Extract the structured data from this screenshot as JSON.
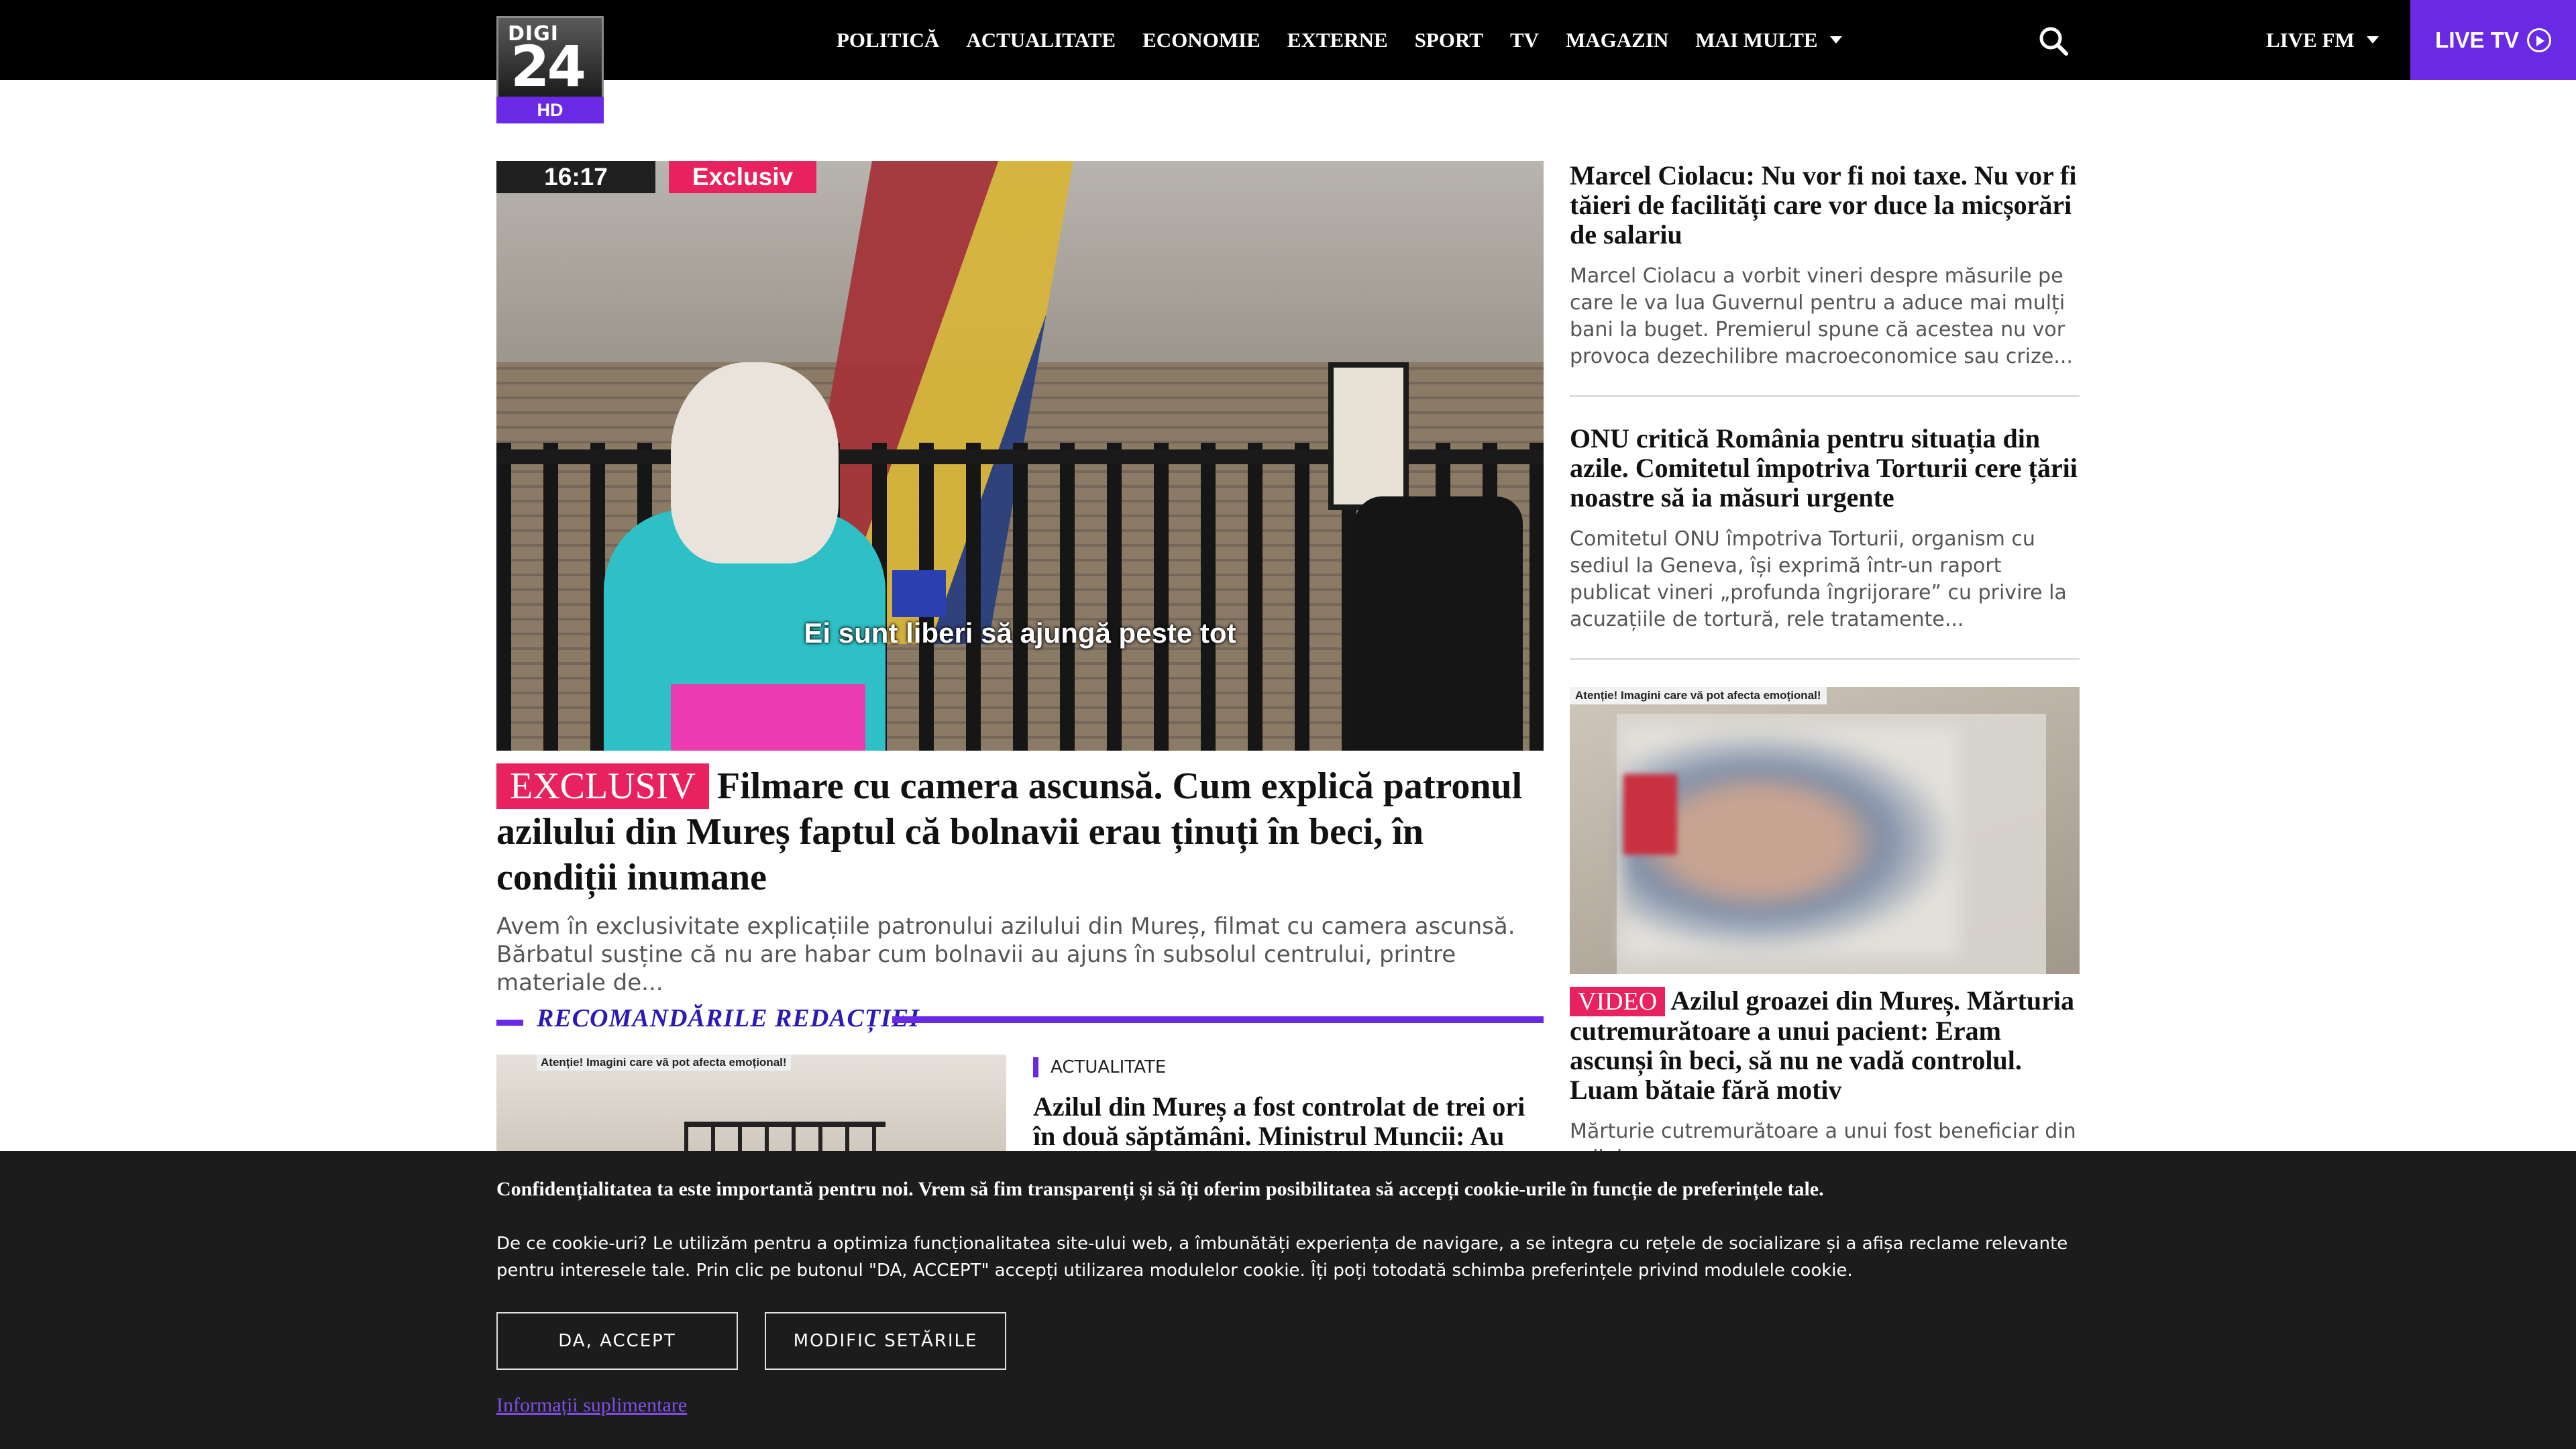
{
  "header": {
    "logo_top": "DIGI",
    "logo_main": "24",
    "logo_hd": "HD",
    "nav": [
      "POLITICĂ",
      "ACTUALITATE",
      "ECONOMIE",
      "EXTERNE",
      "SPORT",
      "TV",
      "MAGAZIN",
      "MAI MULTE"
    ],
    "live_fm": "LIVE FM",
    "live_tv": "LIVE TV"
  },
  "hero": {
    "time": "16:17",
    "badge": "Exclusiv",
    "subtitle": "Ei sunt liberi să ajungă peste tot",
    "tag": "EXCLUSIV",
    "title": "Filmare cu camera ascunsă. Cum explică patronul azilului din Mureș faptul că bolnavii erau ținuți în beci, în condiții inumane",
    "desc": "Avem în exclusivitate explicațiile patronului azilului din Mureș, filmat cu camera ascunsă. Bărbatul susține că nu are habar cum bolnavii au ajuns în subsolul centrului, printre materiale de..."
  },
  "recommend": {
    "heading": "RECOMANDĂRILE REDACȚIEI",
    "img_warning": "Atenție! Imagini care vă pot afecta emoțional!",
    "category": "ACTUALITATE",
    "title": "Azilul din Mureș a fost controlat de trei ori în două săptămâni. Ministrul Muncii: Au"
  },
  "side": [
    {
      "title": "Marcel Ciolacu: Nu vor fi noi taxe. Nu vor fi tăieri de facilități care vor duce la micșorări de salariu",
      "desc": "Marcel Ciolacu a vorbit vineri despre măsurile pe care le va lua Guvernul pentru a aduce mai mulți bani la buget. Premierul spune că acestea nu vor provoca dezechilibre macroeconomice sau crize..."
    },
    {
      "title": "ONU critică România pentru situația din azile. Comitetul împotriva Torturii cere țării noastre să ia măsuri urgente",
      "desc": "Comitetul ONU împotriva Torturii, organism cu sediul la Geneva, își exprimă într-un raport publicat vineri „profunda îngrijorare” cu privire la acuzațiile de tortură, rele tratamente..."
    },
    {
      "img_warning": "Atenție! Imagini care vă pot afecta emoțional!",
      "tag": "VIDEO",
      "title": "Azilul groazei din Mureș. Mărturia cutremurătoare a unui pacient: Eram ascunși în beci, să nu ne vadă controlul. Luam bătaie fără motiv",
      "desc": "Mărturie cutremurătoare a unui fost beneficiar din azilul"
    }
  ],
  "cookie": {
    "title": "Confidențialitatea ta este importantă pentru noi. Vrem să fim transparenți și să îți oferim posibilitatea să accepți cookie-urile în funcție de preferințele tale.",
    "body": "De ce cookie-uri? Le utilizăm pentru a optimiza funcționalitatea site-ului web, a îmbunătăți experiența de navigare, a se integra cu rețele de socializare și a afișa reclame relevante pentru interesele tale. Prin clic pe butonul \"DA, ACCEPT\" accepți utilizarea modulelor cookie. Îți poți totodată schimba preferințele privind modulele cookie.",
    "accept": "DA, ACCEPT",
    "settings": "MODIFIC SETĂRILE",
    "more": "Informații suplimentare"
  },
  "colors": {
    "brand_purple": "#6a29e5",
    "tag_pink": "#e8215f",
    "heading_blue": "#2b1ab5"
  }
}
